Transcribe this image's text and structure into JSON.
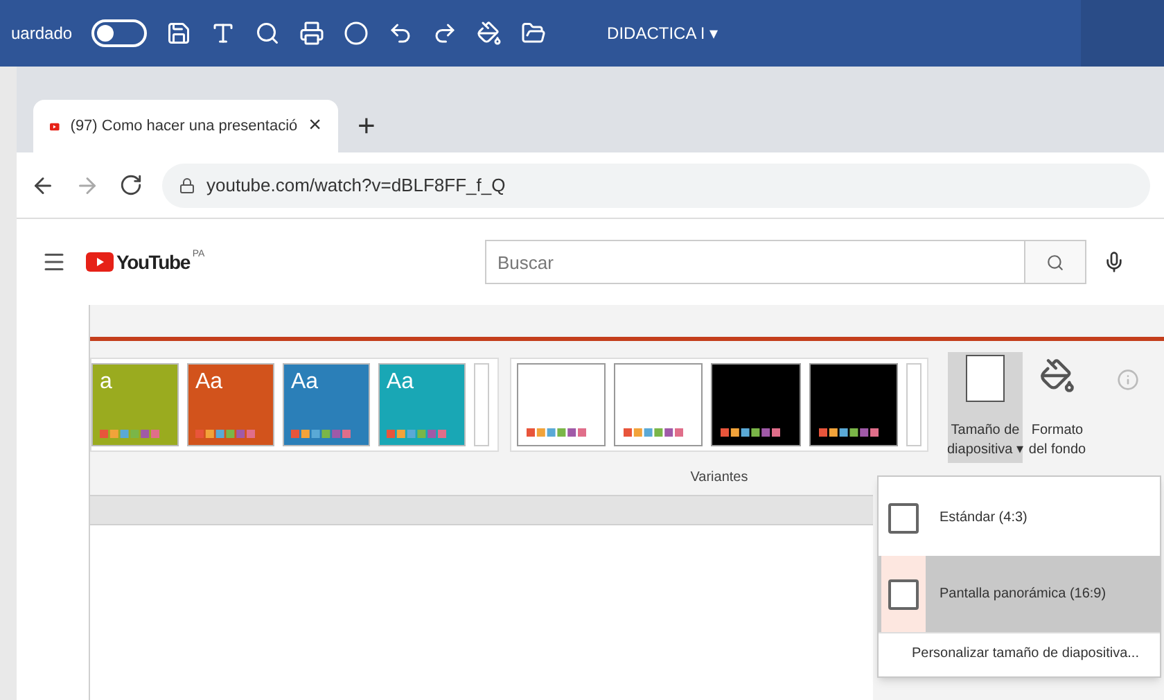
{
  "title_bar": {
    "save_status": "uardado",
    "autosave_on": false,
    "document": "DIDACTICA I",
    "caret": "▾"
  },
  "browser": {
    "tab": {
      "title": "(97) Como hacer una presentació",
      "close": "×"
    },
    "new_tab": "+",
    "url": "youtube.com/watch?v=dBLF8FF_f_Q"
  },
  "youtube": {
    "logo": "YouTube",
    "region": "PA",
    "search": {
      "placeholder": "Buscar"
    }
  },
  "ribbon": {
    "themes": [
      {
        "label": "a",
        "color": "#9aab1f"
      },
      {
        "label": "Aa",
        "color": "#d2531c"
      },
      {
        "label": "Aa",
        "color": "#2b7fb8"
      },
      {
        "label": "Aa",
        "color": "#19a7b5"
      }
    ],
    "variants": [
      {
        "dark": false
      },
      {
        "dark": false
      },
      {
        "dark": true
      },
      {
        "dark": true
      }
    ],
    "variants_label": "Variantes",
    "size_button": {
      "line1": "Tamaño de",
      "line2": "diapositiva",
      "caret": "▾",
      "selected": true
    },
    "format_button": {
      "line1": "Formato",
      "line2": "del fondo"
    }
  },
  "size_menu": [
    {
      "label": "Estándar (4:3)",
      "kind": "option",
      "selected": false
    },
    {
      "label": "Pantalla panorámica (16:9)",
      "kind": "option",
      "selected": true
    },
    {
      "label": "Personalizar tamaño de diapositiva...",
      "kind": "command",
      "selected": false
    }
  ]
}
